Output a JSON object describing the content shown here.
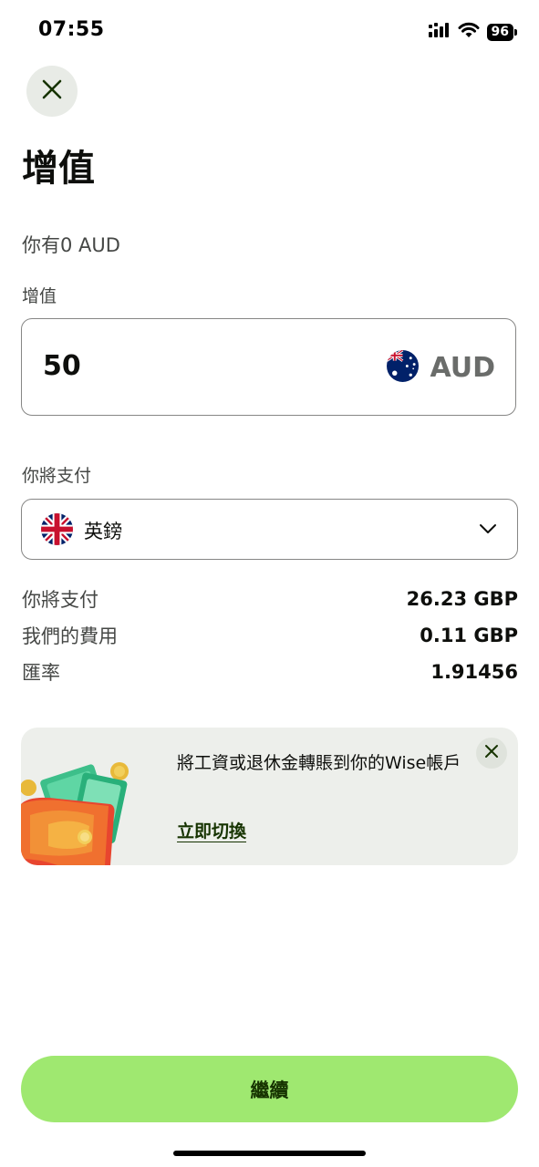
{
  "status_bar": {
    "time": "07:55",
    "battery": "96",
    "icons": [
      "signal-icon",
      "wifi-icon",
      "battery-icon"
    ]
  },
  "header": {
    "close_icon": "close-icon",
    "title": "增值"
  },
  "balance": {
    "text": "你有0 AUD"
  },
  "amount": {
    "label": "增值",
    "value": "50",
    "currency": "AUD",
    "flag_icon": "australia-flag-icon"
  },
  "payment": {
    "label": "你將支付",
    "selected": "英鎊",
    "flag_icon": "uk-flag-icon",
    "chevron_icon": "chevron-down-icon"
  },
  "summary": [
    {
      "label": "你將支付",
      "value": "26.23 GBP"
    },
    {
      "label": "我們的費用",
      "value": "0.11 GBP"
    },
    {
      "label": "匯率",
      "value": "1.91456"
    }
  ],
  "promo": {
    "text": "將工資或退休金轉賬到你的Wise帳戶",
    "link": "立即切換",
    "illustration": "wallet-money-illustration",
    "close_icon": "close-icon"
  },
  "footer": {
    "continue_label": "繼續"
  },
  "colors": {
    "accent": "#9fe870",
    "accent_text": "#163300",
    "promo_bg": "#edefeb",
    "close_bg": "#e8ebe6"
  }
}
